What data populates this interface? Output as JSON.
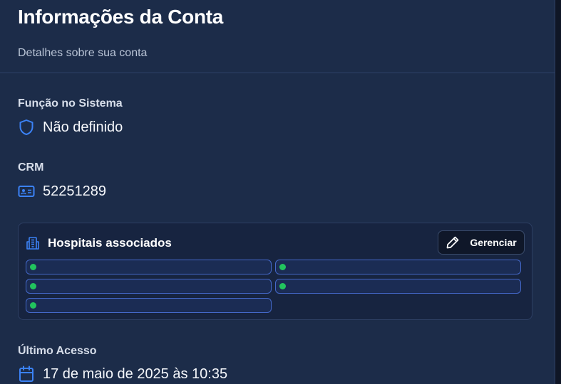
{
  "header": {
    "title": "Informações da Conta",
    "subtitle": "Detalhes sobre sua conta"
  },
  "role": {
    "label": "Função no Sistema",
    "value": "Não definido",
    "icon": "shield-icon"
  },
  "crm": {
    "label": "CRM",
    "value": "52251289",
    "icon": "id-card-icon"
  },
  "hospitals": {
    "title": "Hospitais associados",
    "icon": "building-icon",
    "manage_label": "Gerenciar",
    "manage_icon": "pencil-icon",
    "items": [
      {
        "status": "active"
      },
      {
        "status": "active"
      },
      {
        "status": "active"
      },
      {
        "status": "active"
      },
      {
        "status": "active"
      }
    ]
  },
  "last_access": {
    "label": "Último Acesso",
    "value": "17 de maio de 2025 às 10:35",
    "icon": "calendar-icon"
  },
  "colors": {
    "accent": "#3b82f6",
    "status_active": "#22c55e",
    "card_bg": "#1c2c49"
  }
}
